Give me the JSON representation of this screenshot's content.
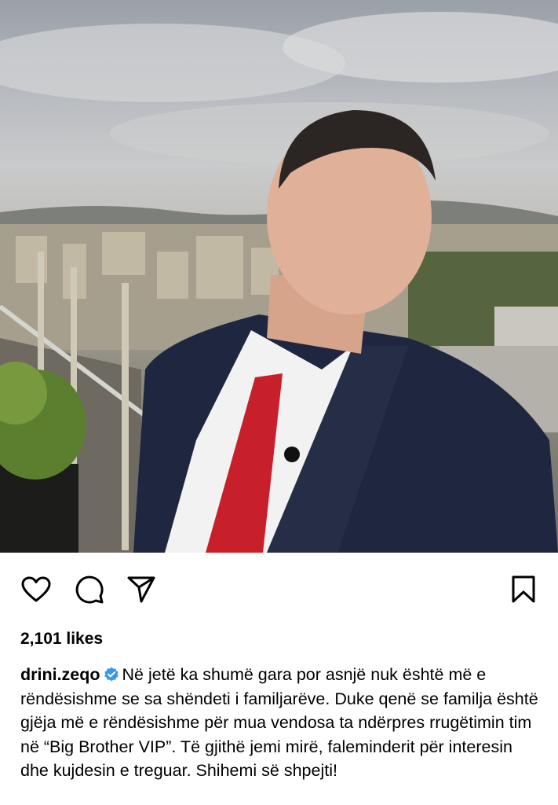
{
  "post": {
    "image_alt": "Man in suit selfie on rooftop",
    "likes": "2,101 likes",
    "username": "drini.zeqo",
    "verified": true,
    "caption": "Në jetë ka shumë gara por asnjë nuk është më e rëndësishme se sa shëndeti i familjarëve. Duke qenë se familja është gjëja më e rëndësishme për mua vendosa ta ndërpres rrugëtimin tim në “Big Brother VIP”. Të gjithë jemi mirë, faleminderit për interesin dhe kujdesin e treguar. Shihemi së shpejti!"
  },
  "icons": {
    "like": "heart-icon",
    "comment": "comment-icon",
    "share": "send-icon",
    "save": "bookmark-icon",
    "verified": "verified-badge-icon"
  },
  "colors": {
    "verified_blue": "#3897f0",
    "tie_red": "#c8202b",
    "suit_navy": "#1f2740"
  }
}
